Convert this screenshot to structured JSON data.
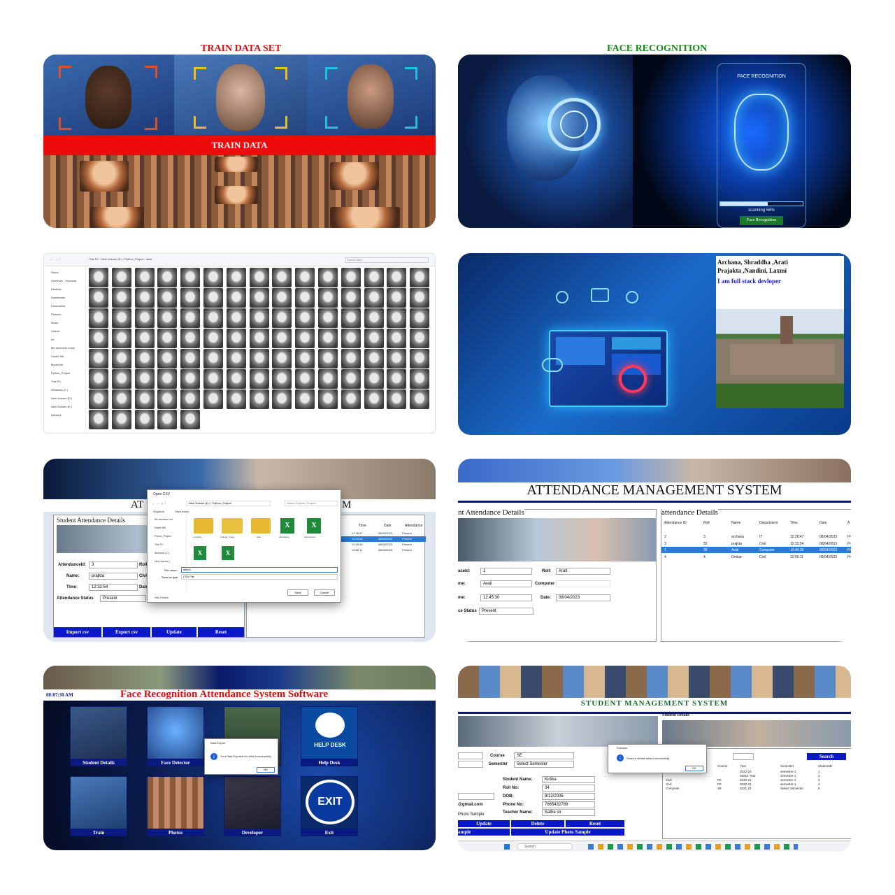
{
  "panel1": {
    "title": "TRAIN DATA SET",
    "banner": "TRAIN DATA",
    "title_color": "#d11313",
    "banner_color": "#ee0b0b"
  },
  "panel2": {
    "title": "FACE RECOGNITION",
    "title_color": "#1a8a1a",
    "hud_title": "FACE RECOGNITION",
    "scan_text": "scanning 58%",
    "button": "Face Recognition",
    "scan_progress": 0.58
  },
  "panel3": {
    "breadcrumb": [
      "This PC",
      "New Volume (E:)",
      "Python_Project",
      "data"
    ],
    "search_placeholder": "Search data",
    "sidebar": [
      "Home",
      "OneDrive - Personal",
      "Desktop",
      "Downloads",
      "Documents",
      "Pictures",
      "Music",
      "Videos",
      "ed",
      "6th semester mock",
      "Hostel Mb",
      "Model file",
      "Python_Project",
      "This PC",
      "Windows (C:)",
      "New Volume (D:)",
      "New Volume (E:)",
      "Network"
    ]
  },
  "panel4": {
    "authors_line1": "Archana, Shraddha ,Arati",
    "authors_line2": "Prajakta ,Nandini, Laxmi",
    "tagline": "I am full stack devloper"
  },
  "panel5": {
    "header_left": "AT",
    "header_right": "M",
    "section_title": "Student Attendance Details",
    "labels": {
      "id": "AttendanceId:",
      "name": "Name:",
      "time": "Time:",
      "status": "Attendance Status",
      "roll": "Roll",
      "dept": "Civil",
      "date": "Date"
    },
    "values": {
      "id": "3",
      "name": "prajkta",
      "time": "12:32:54",
      "status": "Present"
    },
    "buttons": [
      "Import csv",
      "Export csv",
      "Update",
      "Reset"
    ],
    "dialog": {
      "title": "Open CSV",
      "path": [
        "New Volume (E:)",
        "Python_Project"
      ],
      "search": "Search Python_Project",
      "organize": "Organize",
      "new_folder": "New folder",
      "side": [
        "6th semester mo",
        "Hostel Mb",
        "Python_Project",
        "This PC",
        "Windows (C:)",
        "New Volume (",
        "Hide Folders"
      ],
      "folders": [
        "_pycache_",
        "College_image",
        "data",
        "attendance",
        "attendance1"
      ],
      "file_name_label": "File name:",
      "file_name_value": "atten1",
      "save_type_label": "Save as type:",
      "save_type_value": "CSV File",
      "save": "Save",
      "cancel": "Cancel"
    },
    "table": {
      "headers": [
        "Time",
        "Date",
        "Attendance"
      ],
      "rows": [
        [
          "12:28:47",
          "08/04/2023",
          "Present"
        ],
        [
          "12:32:54",
          "08/04/2023",
          "Present"
        ],
        [
          "12:45:30",
          "08/04/2023",
          "Present"
        ],
        [
          "12:56:11",
          "08/04/2023",
          "Present"
        ]
      ]
    }
  },
  "panel6": {
    "title": "ATTENDANCE MANAGEMENT SYSTEM",
    "left_section": "nt Attendance Details",
    "right_section": "attendance Details",
    "labels": {
      "id": "aceId:",
      "roll": "Roll:",
      "name": "me:",
      "dept": "Computer",
      "time": "me:",
      "date": "Date:",
      "status": "ce Status"
    },
    "values": {
      "id": "1",
      "roll": "Arati",
      "name": "Arati",
      "time": "12:45:30",
      "date": "08/04/2023",
      "status": "Present"
    },
    "table": {
      "headers": [
        "Attendance ID",
        "Roll",
        "Name",
        "Department",
        "Time",
        "Date",
        "A"
      ],
      "rows": [
        [
          "2",
          "3",
          "archana",
          "IT",
          "12:28:47",
          "08/04/2023",
          "Pre"
        ],
        [
          "3",
          "52",
          "prajkta",
          "Civil",
          "12:32:54",
          "08/04/2023",
          "Pre"
        ],
        [
          "1",
          "36",
          "Arati",
          "Computer",
          "12:45:30",
          "08/04/2023",
          "Pre"
        ],
        [
          "4",
          "4",
          "Omkar",
          "Civil",
          "12:56:11",
          "08/04/2023",
          "Pre"
        ]
      ]
    }
  },
  "panel7": {
    "clock": "08:07:30 AM",
    "title": "Face Recognition Attendance System Software",
    "tiles": [
      "Student Details",
      "Face Detector",
      "",
      "Help Desk",
      "Train",
      "Photos",
      "Developer",
      "Exit"
    ],
    "help_desk_badge": "HELP DESK",
    "exit_badge": "EXIT",
    "dialog": {
      "title": "Data Export",
      "message": "Your Data Exported to atten1successfully",
      "ok": "OK"
    }
  },
  "panel8": {
    "title": "STUDENT MANAGEMENT SYSTEM",
    "section_title": "Student Details",
    "search_button": "Search",
    "labels": {
      "course": "Course",
      "semester": "Semester",
      "name": "Student Name:",
      "roll": "Roll No:",
      "dob": "DOB:",
      "phone": "Phone No:",
      "teacher": "Teacher Name:",
      "email": "@gmail.com",
      "photo": "Photo Sample"
    },
    "values": {
      "course": "SE",
      "semester": "Select Semester",
      "name": "Kirtika",
      "roll": "34",
      "dob": "8/12/2005",
      "phone": "7865432789",
      "teacher": "Sathe sir"
    },
    "buttons": [
      "Update",
      "Delete",
      "Reset"
    ],
    "buttons_row2": [
      "ample",
      "Update Photo Sample"
    ],
    "dialog": {
      "title": "Success",
      "message": "Student details added successfully",
      "ok": "OK"
    },
    "table": {
      "headers": [
        "Course",
        "Year",
        "Semester",
        "StudentID"
      ],
      "rows": [
        [
          "",
          "2022-23",
          "semester-1",
          "1"
        ],
        [
          "",
          "Select Year",
          "semester-1",
          "2"
        ],
        [
          "FE",
          "2020-21",
          "semester-2",
          "3"
        ],
        [
          "FE",
          "2020-21",
          "semester-1",
          "4"
        ],
        [
          "SE",
          "2021-22",
          "Select Semester",
          "5"
        ]
      ],
      "dept_col": [
        "",
        "",
        "Civil",
        "Civil",
        "Computer"
      ]
    },
    "taskbar_search": "Search"
  }
}
